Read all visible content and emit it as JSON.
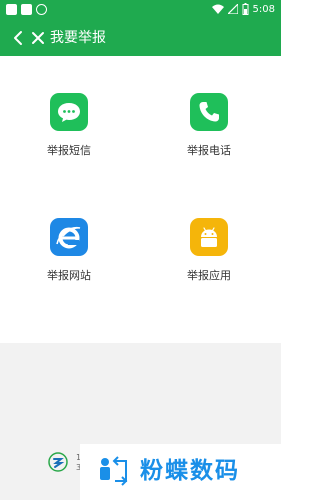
{
  "status_bar": {
    "time": "5:08",
    "battery_icon": "battery-icon",
    "wifi_icon": "wifi-icon",
    "signal_icon": "signal-icon"
  },
  "app_bar": {
    "title": "我要举报",
    "back_icon": "chevron-left-icon",
    "close_icon": "close-icon"
  },
  "items": [
    {
      "label": "举报短信",
      "icon": "sms-icon",
      "color": "#1fbf5a"
    },
    {
      "label": "举报电话",
      "icon": "phone-icon",
      "color": "#1fbf5a"
    },
    {
      "label": "举报网站",
      "icon": "ie-icon",
      "color": "#1e88e5"
    },
    {
      "label": "举报应用",
      "icon": "android-icon",
      "color": "#f5b50a"
    }
  ],
  "footer": {
    "line1": "1",
    "line2": "3"
  },
  "watermark": {
    "text": "粉蝶数码"
  },
  "colors": {
    "primary": "#1faa4f",
    "watermark": "#1a8fe8"
  }
}
